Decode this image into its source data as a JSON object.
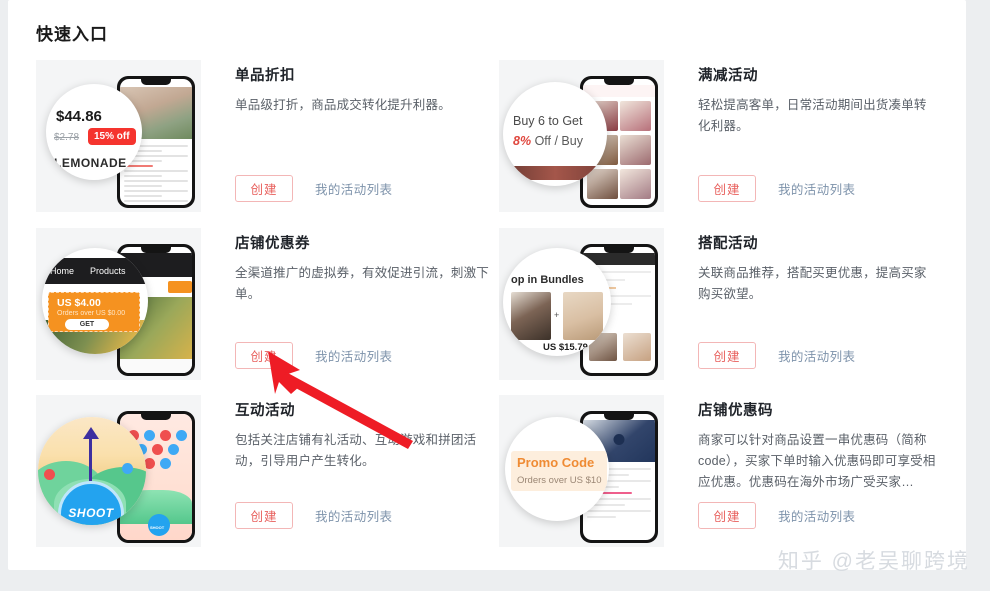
{
  "panel": {
    "title": "快速入口"
  },
  "labels": {
    "create": "创建",
    "my_list": "我的活动列表"
  },
  "watermark": "知乎 @老吴聊跨境",
  "colors": {
    "page_bg": "#eceef0",
    "panel_bg": "#ffffff",
    "thumb_bg": "#f4f5f6",
    "create_border": "#f3b6b6",
    "create_text": "#e8605d",
    "link_text": "#7e93ab",
    "title_text": "#1f2329",
    "desc_text": "#5a6068",
    "annotation_arrow": "#ee1c25"
  },
  "cards": [
    {
      "title": "单品折扣",
      "desc": "单品级打折，商品成交转化提升利器。",
      "create_label": "创建",
      "list_label": "我的活动列表",
      "thumb": {
        "name": "single-item-discount-thumbnail",
        "price": "$44.86",
        "old_price": "$2.78",
        "badge": "15% off",
        "brand": "LEMONADE"
      }
    },
    {
      "title": "满减活动",
      "desc": "轻松提高客单，日常活动期间出货凑单转化利器。",
      "create_label": "创建",
      "list_label": "我的活动列表",
      "thumb": {
        "name": "bulk-discount-thumbnail",
        "line1": "Buy 6 to Get",
        "line2_highlight": "8%",
        "line2_rest": "Off / Buy"
      }
    },
    {
      "title": "店铺优惠券",
      "desc": "全渠道推广的虚拟券，有效促进引流，刺激下单。",
      "create_label": "创建",
      "list_label": "我的活动列表",
      "thumb": {
        "name": "store-coupon-thumbnail",
        "nav_home": "Home",
        "nav_products": "Products",
        "amount": "US $4.00",
        "condition": "Orders over US $0.00",
        "cta": "GET"
      }
    },
    {
      "title": "搭配活动",
      "desc": "关联商品推荐，搭配买更优惠，提高买家购买欲望。",
      "create_label": "创建",
      "list_label": "我的活动列表",
      "thumb": {
        "name": "bundle-deal-thumbnail",
        "heading": "op in Bundles",
        "plus": "+",
        "price": "US $15.79"
      }
    },
    {
      "title": "互动活动",
      "desc": "包括关注店铺有礼活动、互动游戏和拼团活动，引导用户产生转化。",
      "create_label": "创建",
      "list_label": "我的活动列表",
      "thumb": {
        "name": "interactive-game-thumbnail",
        "button": "SHOOT"
      }
    },
    {
      "title": "店铺优惠码",
      "desc": "商家可以针对商品设置一串优惠码（简称code），买家下单时输入优惠码即可享受相应优惠。优惠码在海外市场广受买家…",
      "create_label": "创建",
      "list_label": "我的活动列表",
      "thumb": {
        "name": "promo-code-thumbnail",
        "title_text": "Promo Code",
        "condition": "Orders over US $10"
      }
    }
  ]
}
